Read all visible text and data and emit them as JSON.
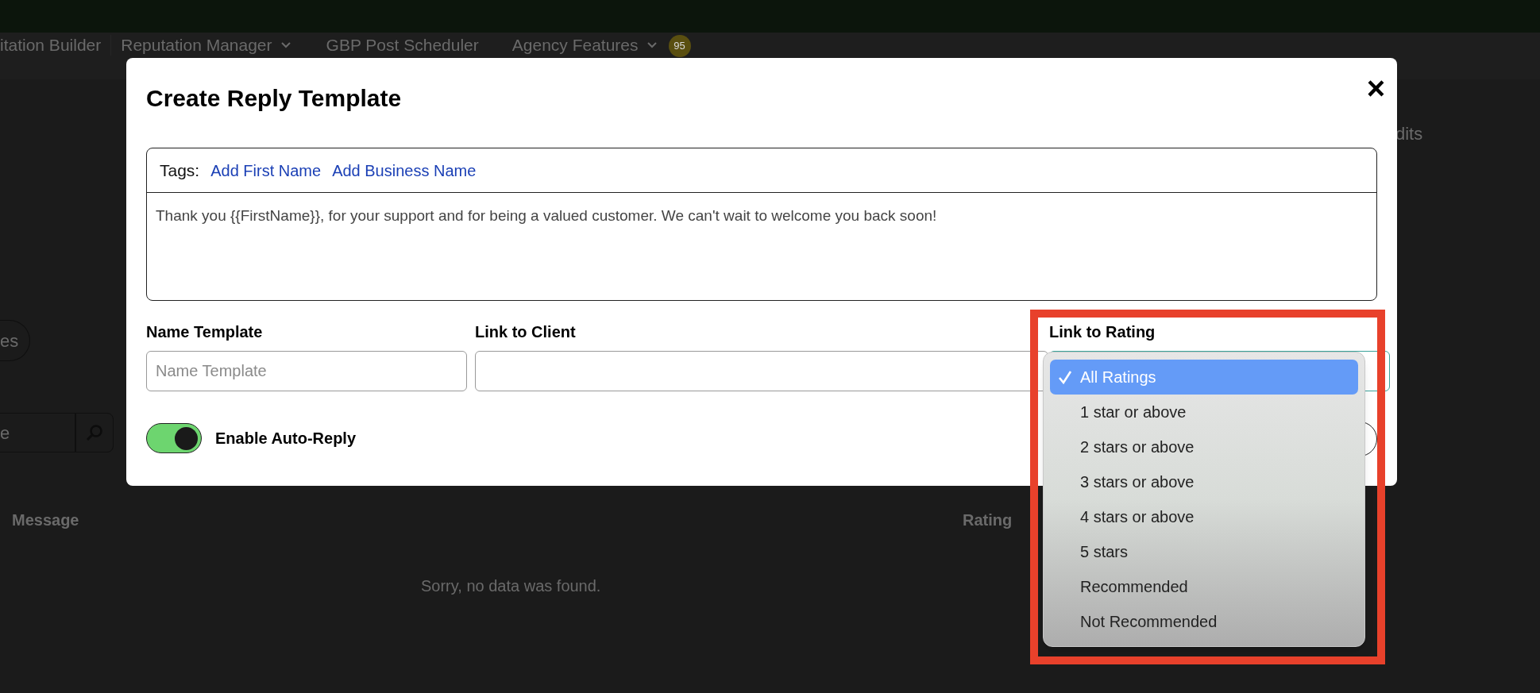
{
  "nav": {
    "items": [
      {
        "label": "itation Builder",
        "dropdown": false
      },
      {
        "label": "Reputation Manager",
        "dropdown": true
      },
      {
        "label": "GBP Post Scheduler",
        "dropdown": false
      },
      {
        "label": "Agency Features",
        "dropdown": true
      }
    ],
    "badge": "95"
  },
  "background": {
    "corner_text": "dits",
    "pill": "es",
    "search": {
      "placeholder": "e"
    },
    "columns": [
      "Message",
      "Rating"
    ],
    "empty": "Sorry, no data was found."
  },
  "modal": {
    "title": "Create Reply Template",
    "close": "×",
    "editor": {
      "tags_label": "Tags:",
      "tags": [
        "Add First Name",
        "Add Business Name"
      ],
      "text": "Thank you {{FirstName}}, for your support and for being a valued customer. We can't wait to welcome you back soon!"
    },
    "fields": [
      {
        "label": "Name Template",
        "kind": "input",
        "placeholder": "Name Template"
      },
      {
        "label": "Link to Client",
        "kind": "select"
      },
      {
        "label": "Link to Rating",
        "kind": "select"
      }
    ],
    "auto_reply": {
      "label": "Enable Auto-Reply",
      "on": true
    }
  },
  "rating_menu": {
    "options": [
      {
        "label": "All Ratings",
        "selected": true
      },
      {
        "label": "1 star or above",
        "selected": false
      },
      {
        "label": "2 stars or above",
        "selected": false
      },
      {
        "label": "3 stars or above",
        "selected": false
      },
      {
        "label": "4 stars or above",
        "selected": false
      },
      {
        "label": "5 stars",
        "selected": false
      },
      {
        "label": "Recommended",
        "selected": false
      },
      {
        "label": "Not Recommended",
        "selected": false
      }
    ]
  },
  "highlight": true
}
